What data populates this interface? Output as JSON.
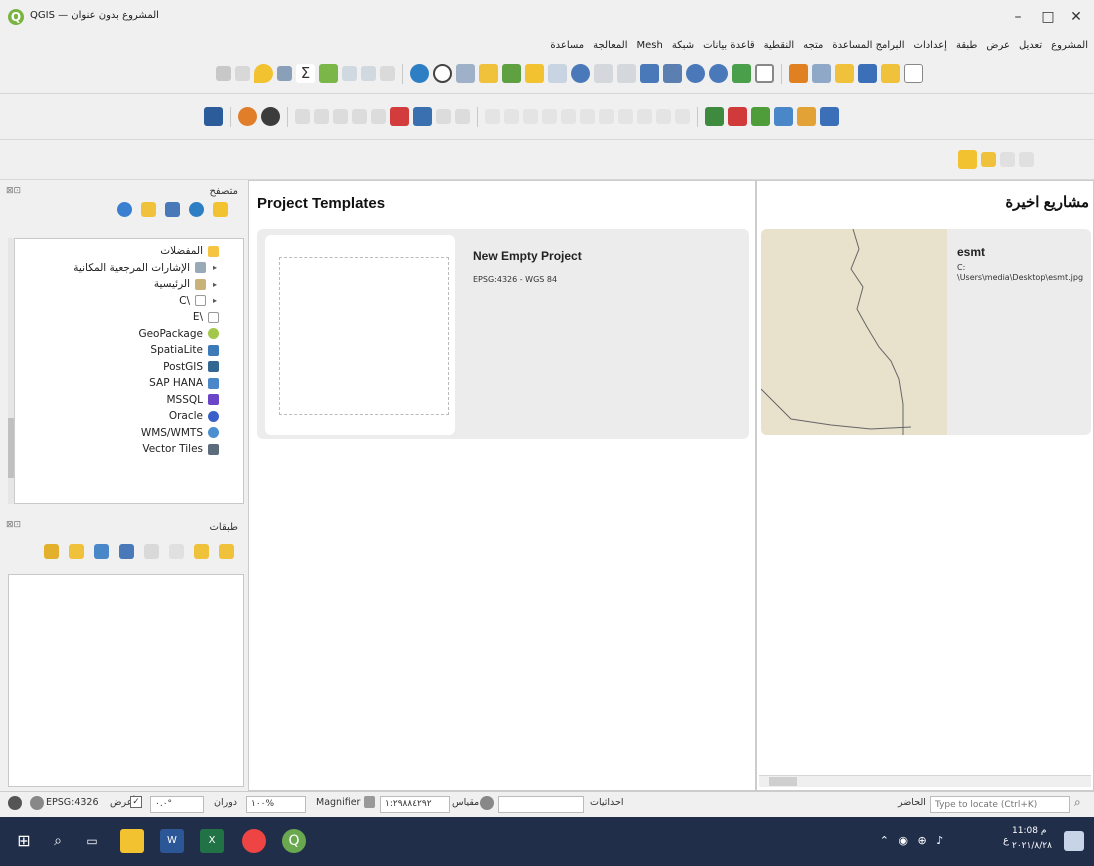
{
  "window": {
    "title": "QGIS — المشروع بدون عنوان",
    "logo_letter": "Q",
    "minimize": "–",
    "maximize": "□",
    "close": "✕"
  },
  "menu": [
    "المشروع",
    "تعديل",
    "عرض",
    "طبقة",
    "إعدادات",
    "البرامج المساعدة",
    "متجه",
    "النقطية",
    "قاعدة بيانات",
    "شبكة",
    "Mesh",
    "المعالجة",
    "مساعدة"
  ],
  "browser": {
    "title": "متصفح",
    "items": [
      {
        "label": "المفضلات",
        "icon": "star-icon",
        "color": "#f5c542",
        "arrow": ""
      },
      {
        "label": "الإشارات المرجعية المكانية",
        "icon": "bookmarks-icon",
        "color": "#9aa9b8",
        "arrow": "▸"
      },
      {
        "label": "الرئيسية",
        "icon": "home-folder-icon",
        "color": "#c9b27a",
        "arrow": "▸"
      },
      {
        "label": "\\C",
        "icon": "drive-icon",
        "color": "#b0b0b0",
        "arrow": "▸"
      },
      {
        "label": "\\E",
        "icon": "drive-icon",
        "color": "#b0b0b0",
        "arrow": ""
      },
      {
        "label": "GeoPackage",
        "icon": "geopackage-icon",
        "color": "#a3c74a",
        "arrow": ""
      },
      {
        "label": "SpatiaLite",
        "icon": "spatialite-icon",
        "color": "#3d7ab8",
        "arrow": ""
      },
      {
        "label": "PostGIS",
        "icon": "postgis-icon",
        "color": "#336791",
        "arrow": ""
      },
      {
        "label": "SAP HANA",
        "icon": "sap-hana-icon",
        "color": "#4a87c8",
        "arrow": ""
      },
      {
        "label": "MSSQL",
        "icon": "mssql-icon",
        "color": "#6b45c7",
        "arrow": ""
      },
      {
        "label": "Oracle",
        "icon": "oracle-icon",
        "color": "#3a5fc8",
        "arrow": ""
      },
      {
        "label": "WMS/WMTS",
        "icon": "wms-icon",
        "color": "#4b8fd0",
        "arrow": ""
      },
      {
        "label": "Vector Tiles",
        "icon": "vector-tiles-icon",
        "color": "#5c6c7c",
        "arrow": ""
      }
    ]
  },
  "layers": {
    "title": "طبقات"
  },
  "templates": {
    "heading": "Project Templates",
    "card_title": "New Empty Project",
    "card_crs": "EPSG:4326 - WGS 84"
  },
  "recent": {
    "heading": "مشاريع اخيرة",
    "card_title": "esmt",
    "card_path_1": "C:",
    "card_path_2": "\\Users\\media\\Desktop\\esmt.jpg"
  },
  "status": {
    "coord_label": "احداثيات",
    "coord_value": "",
    "scale_label": "مقياس",
    "scale_value": "١:٢٩٨٨٤٢٩٢",
    "magnifier_label": "Magnifier",
    "magnifier_value": "١٠٠%",
    "rotation_label": "دوران",
    "rotation_value": "٠.٠°",
    "render_label": "أعرض",
    "crs": "EPSG:4326",
    "locator_placeholder": "Type to locate (Ctrl+K)",
    "locator_label": "الحاضر"
  },
  "taskbar": {
    "time": "11:08 م",
    "date": "٢٠٢١/٨/٢٨",
    "lang": "ع"
  }
}
